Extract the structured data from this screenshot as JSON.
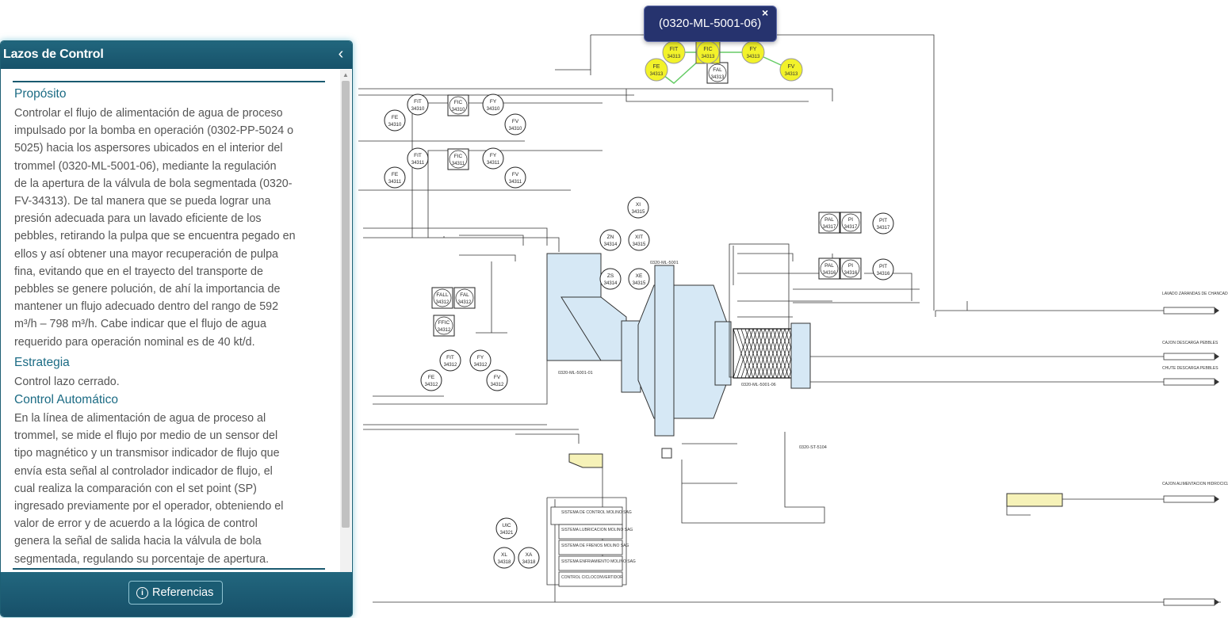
{
  "panel": {
    "title": "Lazos de Control",
    "collapse_icon": "chevron-left-icon",
    "sections": {
      "purpose_title": "Propósito",
      "purpose_lines": [
        "Controlar el flujo de alimentación de agua de proceso",
        "impulsado por la bomba en operación (0302-PP-5024 o",
        "5025) hacia los aspersores ubicados en el interior del",
        "trommel (0320-ML-5001-06), mediante la regulación",
        "de la apertura de la válvula de bola segmentada (0320-",
        "FV-34313). De tal manera que se pueda lograr una",
        "presión adecuada para un lavado eficiente de los",
        "pebbles, retirando la pulpa que se encuentra pegado en",
        "ellos y así obtener una mayor recuperación de pulpa",
        "fina, evitando que en el trayecto del transporte de",
        "pebbles se genere polución, de ahí la importancia de",
        "mantener un flujo adecuado dentro del rango de 592",
        "m³/h – 798 m³/h. Cabe indicar que el flujo de agua",
        "requerido para operación nominal es de 40 kt/d."
      ],
      "strategy_title": "Estrategia",
      "strategy_text": "Control lazo cerrado.",
      "auto_title": "Control Automático",
      "auto_lines": [
        "En la línea de alimentación de agua de proceso al",
        "trommel, se mide el flujo por medio de un sensor del",
        "tipo magnético y un transmisor indicador de flujo que",
        "envía esta señal al controlador indicador de flujo, el",
        "cual realiza la comparación con el set point (SP)",
        "ingresado previamente por el operador, obteniendo el",
        "valor de error y de acuerdo a la lógica de control",
        "genera la señal de salida hacia la válvula de bola",
        "segmentada, regulando su porcentaje de apertura."
      ]
    },
    "footer": {
      "button_label": "Referencias",
      "button_icon": "info-icon"
    }
  },
  "tooltip": {
    "text": "(0320-ML-5001-06)",
    "close": "×"
  },
  "colors": {
    "panel_header": "#1b5a72",
    "highlight": "#f2f22a",
    "equipment": "#d6e8f5",
    "tooltip_bg": "#26336e",
    "line": "#333333"
  },
  "diagram": {
    "highlighted": [
      {
        "tag": "FIT",
        "num": "34313"
      },
      {
        "tag": "FIC",
        "num": "34313"
      },
      {
        "tag": "FY",
        "num": "34313"
      },
      {
        "tag": "FE",
        "num": "34313"
      },
      {
        "tag": "FV",
        "num": "34313"
      }
    ],
    "instruments": [
      {
        "tag": "FIT",
        "num": "34310"
      },
      {
        "tag": "FY",
        "num": "34310"
      },
      {
        "tag": "FE",
        "num": "34310"
      },
      {
        "tag": "FV",
        "num": "34310"
      },
      {
        "tag": "FIT",
        "num": "34311"
      },
      {
        "tag": "FY",
        "num": "34311"
      },
      {
        "tag": "FE",
        "num": "34311"
      },
      {
        "tag": "FV",
        "num": "34311"
      },
      {
        "tag": "XI",
        "num": "34315"
      },
      {
        "tag": "ZN",
        "num": "34314"
      },
      {
        "tag": "XIT",
        "num": "34315"
      },
      {
        "tag": "ZS",
        "num": "34314"
      },
      {
        "tag": "XE",
        "num": "34315"
      },
      {
        "tag": "PIT",
        "num": "34317"
      },
      {
        "tag": "PIT",
        "num": "34316"
      },
      {
        "tag": "FIT",
        "num": "34312"
      },
      {
        "tag": "FY",
        "num": "34312"
      },
      {
        "tag": "FE",
        "num": "34312"
      },
      {
        "tag": "FV",
        "num": "34312"
      },
      {
        "tag": "UIC",
        "num": "34321"
      },
      {
        "tag": "XL",
        "num": "34318"
      },
      {
        "tag": "XA",
        "num": "34318"
      }
    ],
    "boxes": [
      {
        "tag": "FIC",
        "num": "34310"
      },
      {
        "tag": "FIC",
        "num": "34311"
      },
      {
        "tag": "FAL",
        "num": "34313"
      },
      {
        "tag": "PAL",
        "num": "34317"
      },
      {
        "tag": "PI",
        "num": "34317"
      },
      {
        "tag": "PAL",
        "num": "34316"
      },
      {
        "tag": "PI",
        "num": "34316"
      },
      {
        "tag": "FALL",
        "num": "34312"
      },
      {
        "tag": "FAL",
        "num": "34312"
      },
      {
        "tag": "FFIC",
        "num": "34312"
      }
    ],
    "equipment_labels": [
      "0320-ML-5001-01",
      "0320-ML-5001-06",
      "0320-ML-5001",
      "0320-ST-5104"
    ],
    "control_system": {
      "title": "SISTEMA DE CONTROL MOLINO SAG",
      "items": [
        "SISTEMA LUBRICACION MOLINO SAG",
        "SISTEMA DE FRENOS MOLINO SAG",
        "SISTEMA ENFRIAMIENTO MOLINO SAG",
        "CONTROL CICLOCONVERTIDOR"
      ]
    },
    "right_labels": [
      "LAVADO ZARANDAS DE CHANCADO",
      "CAJON DESCARGA PEBBLES",
      "CHUTE DESCARGA PEBBLES",
      "CAJON ALIMENTACION HIDROCICLONES"
    ]
  }
}
